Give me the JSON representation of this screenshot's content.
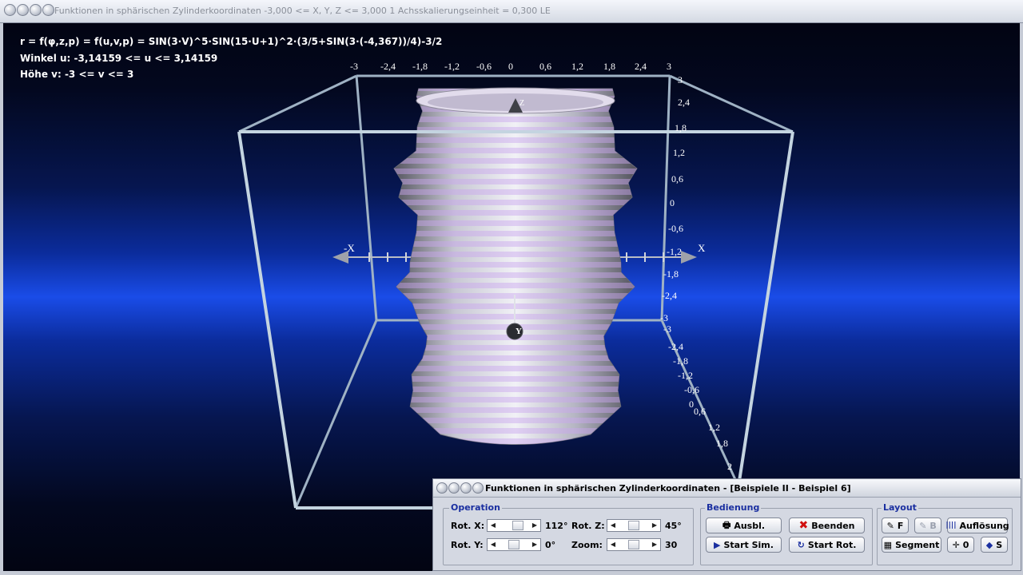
{
  "window": {
    "title": "Funktionen in sphärischen Zylinderkoordinaten   -3,000 <= X, Y, Z <= 3,000    1 Achsskalierungseinheit = 0,300 LE"
  },
  "info": {
    "formula": "r = f(φ,z,p) = f(u,v,p) = SIN(3·V)^5·SIN(15·U+1)^2·(3/5+SIN(3·(-4,367))/4)-3/2",
    "winkel": "Winkel u: -3,14159 <= u <= 3,14159",
    "hoehe": "Höhe v: -3 <= v <= 3"
  },
  "axes": {
    "x_label": "X",
    "neg_x_label": "-X",
    "y_label": "Y",
    "z_label": "Z",
    "top_ticks": [
      "-3",
      "-2,4",
      "-1,8",
      "-1,2",
      "-0,6",
      "0",
      "0,6",
      "1,2",
      "1,8",
      "2,4",
      "3"
    ],
    "right_ticks_1": [
      "3",
      "2,4",
      "1,8",
      "1,2",
      "0,6",
      "0",
      "-0,6",
      "-1,2",
      "-1,8",
      "-2,4",
      "-3"
    ],
    "right_ticks_2": [
      "-3",
      "-2,4",
      "-1,8",
      "-1,2",
      "-0,6",
      "0",
      "0,6",
      "1,2",
      "1,8",
      "2"
    ]
  },
  "dialog": {
    "title": "Funktionen in sphärischen Zylinderkoordinaten - [Beispiele II - Beispiel 6]",
    "operation": {
      "label": "Operation",
      "rot_x_label": "Rot. X:",
      "rot_x_value": "112°",
      "rot_x_pos": 0.72,
      "rot_y_label": "Rot. Y:",
      "rot_y_value": "0°",
      "rot_y_pos": 0.5,
      "rot_z_label": "Rot. Z:",
      "rot_z_value": "45°",
      "rot_z_pos": 0.5,
      "zoom_label": "Zoom:",
      "zoom_value": "30",
      "zoom_pos": 0.5
    },
    "bedienung": {
      "label": "Bedienung",
      "ausbl": "Ausbl.",
      "beenden": "Beenden",
      "start_sim": "Start Sim.",
      "start_rot": "Start Rot."
    },
    "layout": {
      "label": "Layout",
      "f": "F",
      "b": "B",
      "aufloesung": "Auflösung",
      "segment": "Segment",
      "zero": "0",
      "s": "S"
    }
  },
  "colors": {
    "accent": "#1a2fa0",
    "stripe": "#c8aee6",
    "surface": "#d8d8e2",
    "box": "#b8c8d4"
  }
}
